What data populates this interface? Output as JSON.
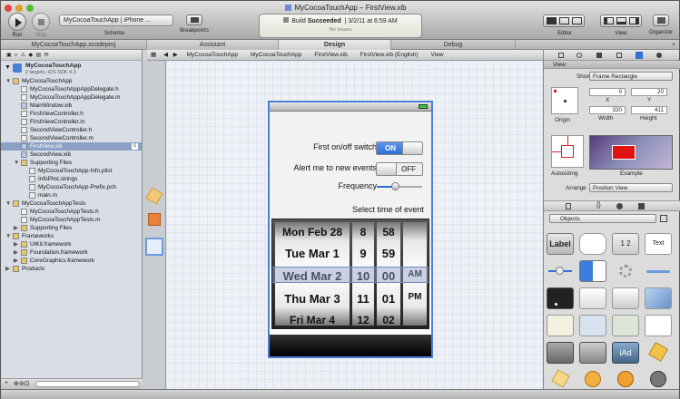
{
  "window": {
    "title": "MyCocoaTouchApp – FirstView.xib"
  },
  "toolbar": {
    "run": "Run",
    "stop": "Stop",
    "scheme_label": "Scheme",
    "scheme_value": "MyCocoaTouchApp | iPhone ...",
    "breakpoints": "Breakpoints",
    "editor": "Editor",
    "view": "View",
    "organizer": "Organizer",
    "activity_status_prefix": "Build",
    "activity_status_word": "Succeeded",
    "activity_time": "3/2/11 at 6:59 AM",
    "activity_sub": "No Issues"
  },
  "tabs": {
    "project": "MyCocoaTouchApp.xcodeproj",
    "assistant": "Assistant",
    "design": "Design",
    "debug": "Debug"
  },
  "jumpbar": [
    "MyCocoaTouchApp",
    "MyCocoaTouchApp",
    "FirstView.xib",
    "FirstView.xib (English)",
    "View"
  ],
  "navigator": {
    "project_name": "MyCocoaTouchApp",
    "project_sub": "2 targets, iOS SDK 4.3",
    "items": [
      {
        "label": "MyCocoaTouchApp",
        "indent": 1,
        "type": "folder",
        "open": true
      },
      {
        "label": "MyCocoaTouchAppAppDelegate.h",
        "indent": 2,
        "type": "h"
      },
      {
        "label": "MyCocoaTouchAppAppDelegate.m",
        "indent": 2,
        "type": "m"
      },
      {
        "label": "MainWindow.xib",
        "indent": 2,
        "type": "xib"
      },
      {
        "label": "FirstViewController.h",
        "indent": 2,
        "type": "h"
      },
      {
        "label": "FirstViewController.m",
        "indent": 2,
        "type": "m"
      },
      {
        "label": "SecondViewController.h",
        "indent": 2,
        "type": "h"
      },
      {
        "label": "SecondViewController.m",
        "indent": 2,
        "type": "m"
      },
      {
        "label": "FirstView.xib",
        "indent": 2,
        "type": "xib",
        "selected": true,
        "badge": "U"
      },
      {
        "label": "SecondView.xib",
        "indent": 2,
        "type": "xib"
      },
      {
        "label": "Supporting Files",
        "indent": 2,
        "type": "folder",
        "open": true
      },
      {
        "label": "MyCocoaTouchApp-Info.plist",
        "indent": 3,
        "type": "plist"
      },
      {
        "label": "InfoPlist.strings",
        "indent": 3,
        "type": "strings"
      },
      {
        "label": "MyCocoaTouchApp-Prefix.pch",
        "indent": 3,
        "type": "pch"
      },
      {
        "label": "main.m",
        "indent": 3,
        "type": "m"
      },
      {
        "label": "MyCocoaTouchAppTests",
        "indent": 1,
        "type": "folder",
        "open": true
      },
      {
        "label": "MyCocoaTouchAppTests.h",
        "indent": 2,
        "type": "h"
      },
      {
        "label": "MyCocoaTouchAppTests.m",
        "indent": 2,
        "type": "m"
      },
      {
        "label": "Supporting Files",
        "indent": 2,
        "type": "folder",
        "open": false
      },
      {
        "label": "Frameworks",
        "indent": 1,
        "type": "folder",
        "open": true
      },
      {
        "label": "UIKit.framework",
        "indent": 2,
        "type": "framework",
        "open": false
      },
      {
        "label": "Foundation.framework",
        "indent": 2,
        "type": "framework",
        "open": false
      },
      {
        "label": "CoreGraphics.framework",
        "indent": 2,
        "type": "framework",
        "open": false
      },
      {
        "label": "Products",
        "indent": 1,
        "type": "folder",
        "open": false
      }
    ]
  },
  "phone": {
    "first_label": "First on/off switch",
    "first_state": "ON",
    "second_label": "Alert me to new events",
    "second_state": "OFF",
    "freq_label": "Frequency",
    "slider_level": 0.4,
    "select_label": "Select time of event",
    "picker": {
      "days": [
        "Mon Feb 28",
        "Tue Mar 1",
        "Wed Mar 2",
        "Thu Mar 3",
        "Fri Mar 4"
      ],
      "hours": [
        "8",
        "9",
        "10",
        "11",
        "12"
      ],
      "minutes": [
        "58",
        "59",
        "00",
        "01",
        "02"
      ],
      "ampm": [
        "AM",
        "PM"
      ]
    }
  },
  "inspector": {
    "section_view": "View",
    "show_label": "Show",
    "show_value": "Frame Rectangle",
    "origin": "Origin",
    "x_label": "X",
    "y_label": "Y",
    "width_label": "Width",
    "height_label": "Height",
    "x": "0",
    "y": "20",
    "w": "320",
    "h": "411",
    "autosizing": "Autosizing",
    "example": "Example",
    "arrange_label": "Arrange",
    "arrange_value": "Position View",
    "library_filter": "Objects",
    "library": [
      "Label",
      "",
      "1 2",
      "Text"
    ]
  },
  "colors": {
    "accent": "#4a7fd8",
    "on_switch": "#2f6fd6",
    "selected_row": "#8aa0c6"
  }
}
